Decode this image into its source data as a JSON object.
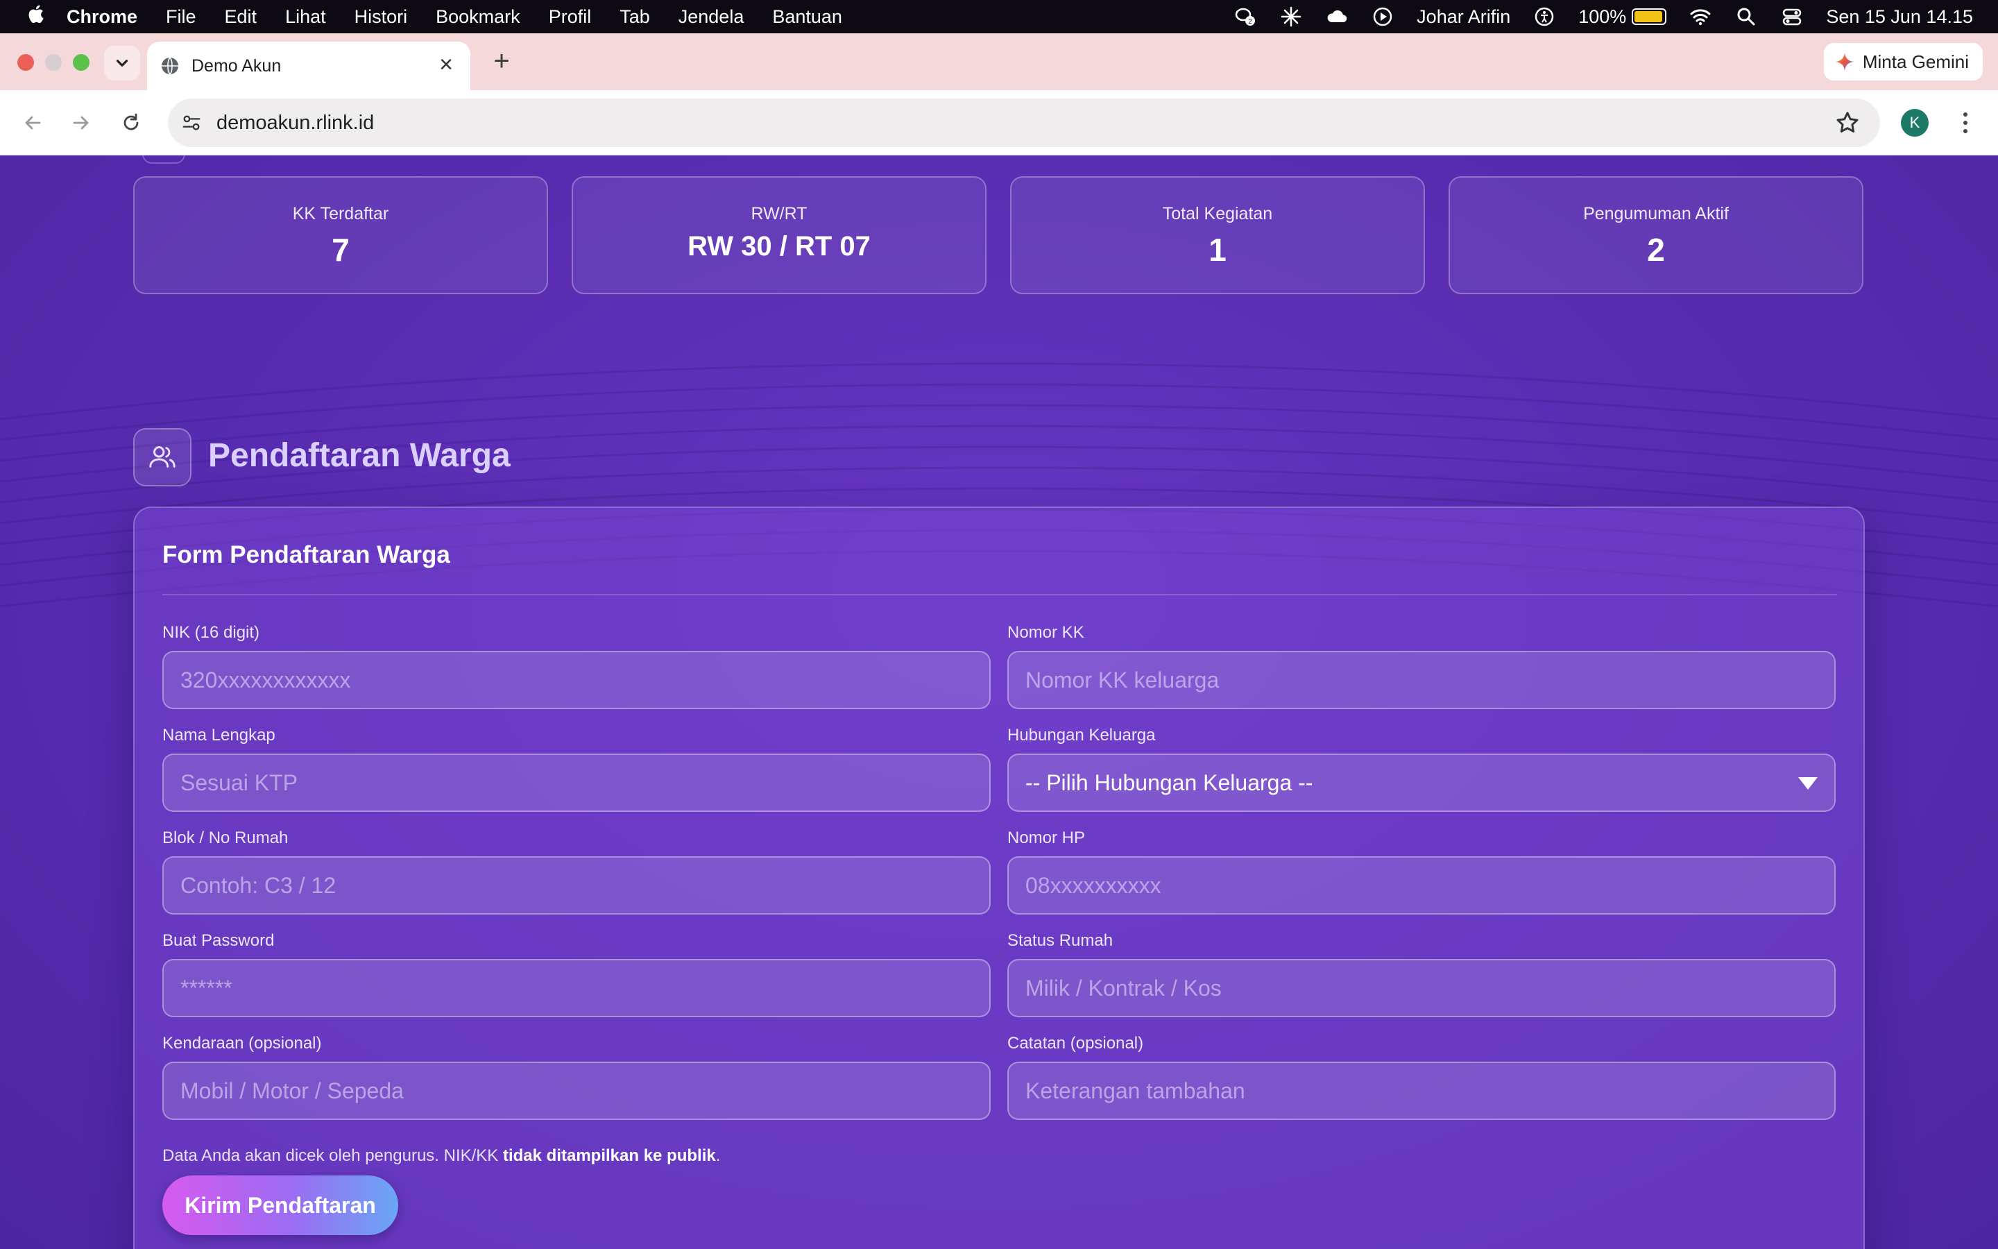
{
  "menubar": {
    "app": "Chrome",
    "items": [
      "File",
      "Edit",
      "Lihat",
      "Histori",
      "Bookmark",
      "Profil",
      "Tab",
      "Jendela",
      "Bantuan"
    ],
    "user": "Johar Arifin",
    "battery": "100%",
    "datetime": "Sen 15 Jun  14.15",
    "wechat_badge": "2"
  },
  "browser": {
    "tab_title": "Demo Akun",
    "gemini_label": "Minta Gemini",
    "url": "demoakun.rlink.id",
    "profile_initial": "K"
  },
  "stats": [
    {
      "label": "KK Terdaftar",
      "value": "7"
    },
    {
      "label": "RW/RT",
      "value": "RW 30 / RT 07"
    },
    {
      "label": "Total Kegiatan",
      "value": "1"
    },
    {
      "label": "Pengumuman Aktif",
      "value": "2"
    }
  ],
  "section": {
    "title": "Pendaftaran Warga"
  },
  "form": {
    "title": "Form Pendaftaran Warga",
    "nik": {
      "label": "NIK (16 digit)",
      "placeholder": "320xxxxxxxxxxxx"
    },
    "no_kk": {
      "label": "Nomor KK",
      "placeholder": "Nomor KK keluarga"
    },
    "nama": {
      "label": "Nama Lengkap",
      "placeholder": "Sesuai KTP"
    },
    "hubungan": {
      "label": "Hubungan Keluarga",
      "value": "-- Pilih Hubungan Keluarga --"
    },
    "blok": {
      "label": "Blok / No Rumah",
      "placeholder": "Contoh: C3 / 12"
    },
    "hp": {
      "label": "Nomor HP",
      "placeholder": "08xxxxxxxxxx"
    },
    "password": {
      "label": "Buat Password",
      "placeholder": "******"
    },
    "status": {
      "label": "Status Rumah",
      "placeholder": "Milik / Kontrak / Kos"
    },
    "kendaraan": {
      "label": "Kendaraan (opsional)",
      "placeholder": "Mobil / Motor / Sepeda"
    },
    "catatan": {
      "label": "Catatan (opsional)",
      "placeholder": "Keterangan tambahan"
    },
    "note_prefix": "Data Anda akan dicek oleh pengurus. NIK/KK ",
    "note_bold": "tidak ditampilkan ke publik",
    "note_suffix": ".",
    "submit_label": "Kirim Pendaftaran"
  },
  "colors": {
    "page_bg": "#5b2fb5",
    "tab_strip": "#f5d8da",
    "section_title": "#d9d0ff",
    "button_gradient_start": "#d65af0",
    "button_gradient_end": "#6aa6f5"
  }
}
